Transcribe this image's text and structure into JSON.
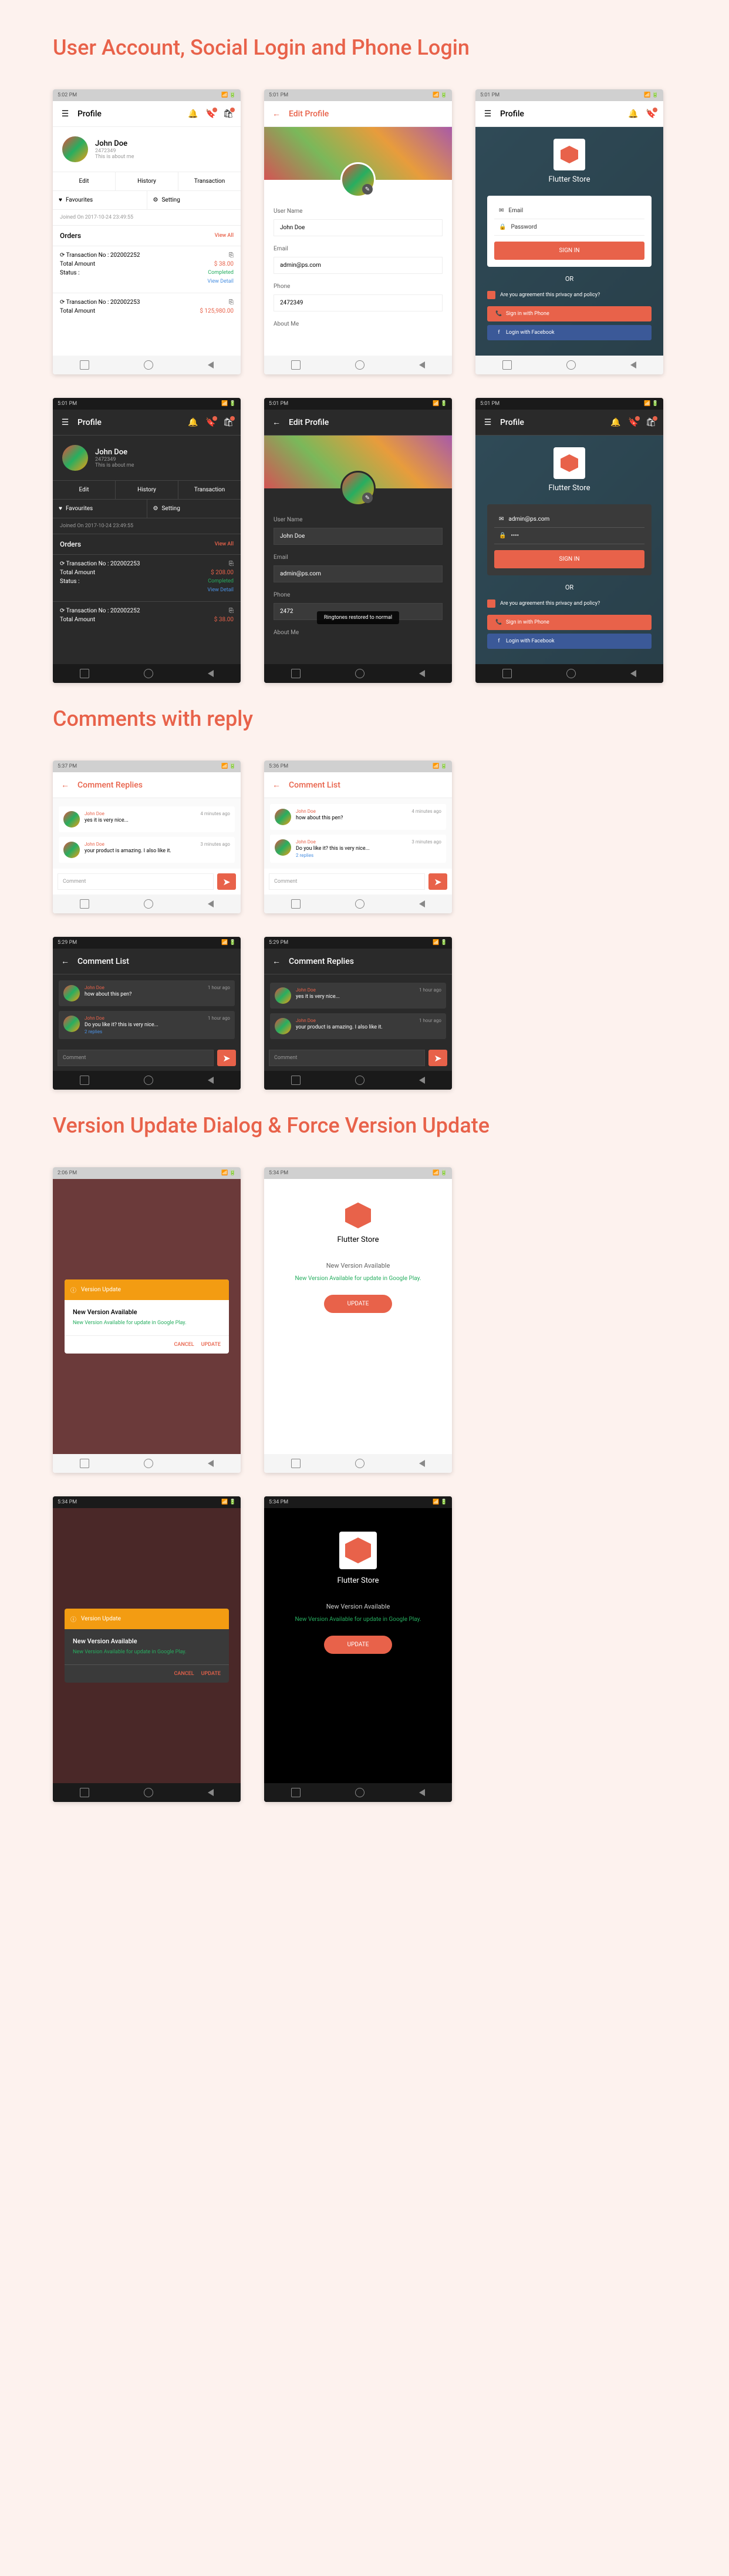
{
  "section1_title": "User Account,  Social Login and Phone Login",
  "section2_title": "Comments with reply",
  "section3_title": "Version Update Dialog & Force Version Update",
  "status": {
    "time_a": "5:02 PM",
    "time_b": "5:01 PM",
    "time_c": "5:29 PM",
    "time_d": "2:06 PM",
    "time_e": "5:34 PM",
    "time_f": "5:37 PM",
    "time_g": "5:36 PM",
    "net": "📶",
    "batt": "🔋"
  },
  "profile": {
    "title": "Profile",
    "name": "John Doe",
    "id": "2472349",
    "about": "This is about me",
    "tabs": {
      "edit": "Edit",
      "history": "History",
      "transaction": "Transaction"
    },
    "fav": "Favourites",
    "setting": "Setting",
    "joined": "Joined On 2017-10-24 23:49:55",
    "orders": "Orders",
    "viewall": "View All",
    "txn1": "Transaction No : 202002252",
    "txn2": "Transaction No : 202002253",
    "total": "Total Amount",
    "amt1": "$ 38.00",
    "amt2": "$ 125,980.00",
    "amt3": "$ 208.00",
    "amt4": "$ 38.00",
    "statuslbl": "Status :",
    "completed": "Completed",
    "detail": "View Detail"
  },
  "edit": {
    "title": "Edit Profile",
    "un_label": "User Name",
    "un_val": "John Doe",
    "em_label": "Email",
    "em_val": "admin@ps.com",
    "ph_label": "Phone",
    "ph_val": "2472349",
    "ph_val2": "2472",
    "ab_label": "About Me",
    "toast": "Ringtones restored to normal"
  },
  "login": {
    "email": "Email",
    "password": "Password",
    "signin": "SIGN IN",
    "or": "OR",
    "policy": "Are you agreement this privacy and policy?",
    "phone_btn": "Sign in with Phone",
    "fb_btn": "Login with Facebook",
    "admin": "admin@ps.com",
    "dots": "••••"
  },
  "comments": {
    "replies_title": "Comment Replies",
    "list_title": "Comment List",
    "author": "John Doe",
    "c1": "yes it is very nice...",
    "c2": "your product is amazing. I also like it.",
    "c3": "how about this pen?",
    "c4": "Do you like it? this is very nice...",
    "replies": "2 replies",
    "time1": "4 minutes ago",
    "time2": "3 minutes ago",
    "time3": "1 hour ago",
    "placeholder": "Comment"
  },
  "update": {
    "header": "Version Update",
    "title": "New Version Available",
    "msg": "New Version Available for update in Google Play.",
    "cancel": "CANCEL",
    "update": "UPDATE",
    "store": "Flutter Store",
    "sub": "New Version Available",
    "force_btn": "UPDATE"
  }
}
